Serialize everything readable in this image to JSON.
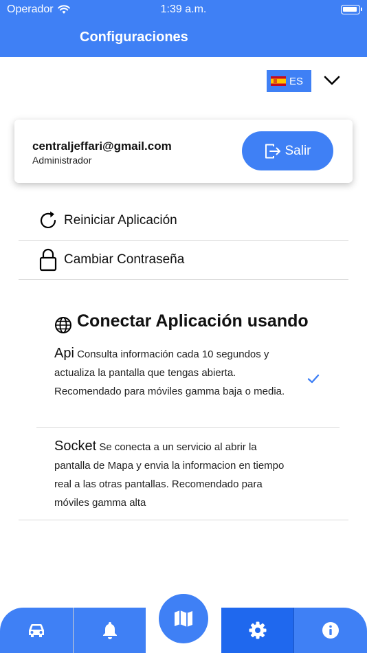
{
  "status_bar": {
    "carrier": "Operador",
    "time": "1:39 a.m."
  },
  "header": {
    "title": "Configuraciones"
  },
  "language": {
    "code": "ES",
    "flag": "spain-flag-icon"
  },
  "user": {
    "email": "centraljeffari@gmail.com",
    "role": "Administrador",
    "logout_label": "Salir"
  },
  "menu": [
    {
      "label": "Reiniciar Aplicación",
      "icon": "refresh-icon"
    },
    {
      "label": "Cambiar Contraseña",
      "icon": "lock-icon"
    }
  ],
  "connect": {
    "title": "Conectar Aplicación usando",
    "options": [
      {
        "name": "Api",
        "description": "Consulta información cada 10 segundos y actualiza la pantalla que tengas abierta. Recomendado para móviles gamma baja o media.",
        "selected": true
      },
      {
        "name": "Socket",
        "description": "Se conecta a un servicio al abrir la pantalla de Mapa y envia la informacion en tiempo real a las otras pantallas. Recomendado para móviles gamma alta",
        "selected": false
      }
    ]
  },
  "tabs": [
    {
      "icon": "car-icon",
      "active": false
    },
    {
      "icon": "bell-icon",
      "active": false
    },
    {
      "icon": "map-icon",
      "active": false
    },
    {
      "icon": "gear-icon",
      "active": true
    },
    {
      "icon": "info-icon",
      "active": false
    }
  ],
  "colors": {
    "primary": "#3f80f5",
    "active_tab": "#1f68ee"
  }
}
